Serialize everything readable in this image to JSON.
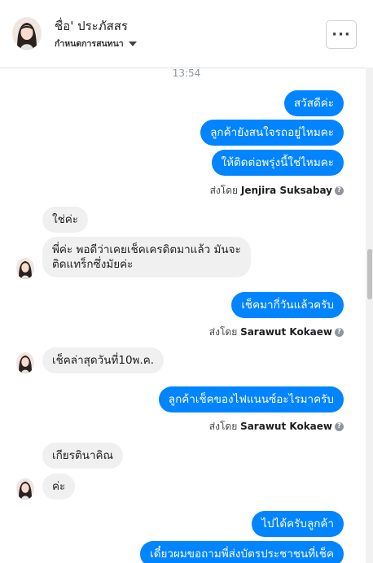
{
  "header": {
    "contact_name": "ชื่อ' ประภัสสร",
    "conversation_management": "กำหนดการสนทนา",
    "more_label": "···"
  },
  "messages": {
    "timestamp": "13:54",
    "items": [
      {
        "text": "สวัสดีค่ะ"
      },
      {
        "text": "ลูกค้ายังสนใจรถอยู่ไหมคะ"
      },
      {
        "text": "ให้ติดต่อพรุ่งนี้ใช่ไหมคะ"
      },
      {
        "sent_by_prefix": "ส่งโดย",
        "sent_by_name": "Jenjira Suksabay"
      },
      {
        "text": "ใช่ค่ะ"
      },
      {
        "text_line1": "พี่ค่ะ พอดีว่าเคยเช็คเครดิตมาแล้ว มันจะ",
        "text_line2": "ติดแทร็กซึ่งมัยค่ะ"
      },
      {
        "text": "เช็คมากี่วันแล้วครับ"
      },
      {
        "sent_by_prefix": "ส่งโดย",
        "sent_by_name": "Sarawut Kokaew"
      },
      {
        "text": "เช็คล่าสุดวันที่10พ.ค."
      },
      {
        "text": "ลูกค้าเช็คของไฟแนนซ์อะไรมาครับ"
      },
      {
        "sent_by_prefix": "ส่งโดย",
        "sent_by_name": "Sarawut Kokaew"
      },
      {
        "text": "เกียรตินาคิณ"
      },
      {
        "text": "ค่ะ"
      },
      {
        "text": "ไปได้ครับลูกค้า"
      },
      {
        "text": "เดี๋ยวผมขอถามพี่ส่งบัตรประชาชนที่เช็ค"
      }
    ]
  },
  "colors": {
    "outgoing_bubble": "#0084ff",
    "incoming_bubble": "#f1f0f0"
  }
}
